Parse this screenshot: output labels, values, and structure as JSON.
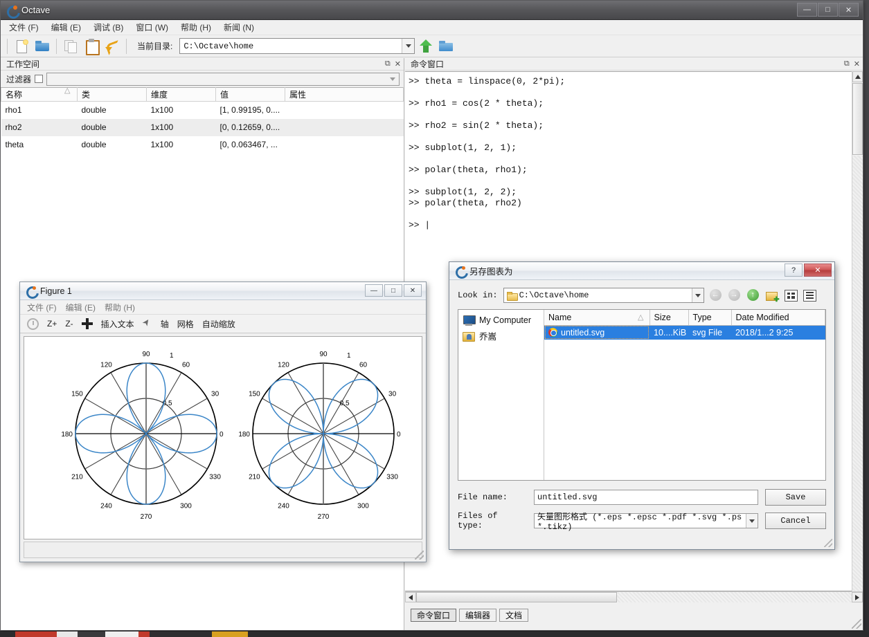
{
  "desktop": {
    "bg_color": "#3b3b3e"
  },
  "main_window": {
    "title": "Octave",
    "logo_icon": "octave-logo-icon",
    "controls": {
      "minimize": "—",
      "maximize": "□",
      "close": "✕"
    },
    "menubar": [
      {
        "label": "文件 (F)",
        "name": "menu-file"
      },
      {
        "label": "编辑 (E)",
        "name": "menu-edit"
      },
      {
        "label": "调试 (B)",
        "name": "menu-debug"
      },
      {
        "label": "窗口 (W)",
        "name": "menu-window"
      },
      {
        "label": "帮助 (H)",
        "name": "menu-help"
      },
      {
        "label": "新闻 (N)",
        "name": "menu-news"
      }
    ],
    "toolbar": {
      "icons": [
        "new-file-icon",
        "open-folder-icon",
        "copy-icon",
        "paste-icon",
        "undo-icon"
      ],
      "curdir_label": "当前目录:",
      "curdir_value": "C:\\Octave\\home",
      "up_icon": "up-arrow-icon",
      "browse_icon": "browse-folder-icon"
    }
  },
  "workspace": {
    "title": "工作空间",
    "undock_icon": "undock-icon",
    "close_icon": "close-icon",
    "filter_label": "过滤器",
    "filter_value": "",
    "columns": [
      "名称",
      "类",
      "维度",
      "值",
      "属性"
    ],
    "rows": [
      {
        "name": "rho1",
        "class": "double",
        "dimension": "1x100",
        "value": "[1, 0.99195, 0....",
        "attribute": ""
      },
      {
        "name": "rho2",
        "class": "double",
        "dimension": "1x100",
        "value": "[0, 0.12659, 0....",
        "attribute": ""
      },
      {
        "name": "theta",
        "class": "double",
        "dimension": "1x100",
        "value": "[0, 0.063467, ...",
        "attribute": ""
      }
    ]
  },
  "command_window": {
    "title": "命令窗口",
    "undock_icon": "undock-icon",
    "close_icon": "close-icon",
    "text": ">> theta = linspace(0, 2*pi);\n\n>> rho1 = cos(2 * theta);\n\n>> rho2 = sin(2 * theta);\n\n>> subplot(1, 2, 1);\n\n>> polar(theta, rho1);\n\n>> subplot(1, 2, 2);\n>> polar(theta, rho2)\n\n>> |",
    "tabs": [
      {
        "label": "命令窗口",
        "active": true
      },
      {
        "label": "编辑器",
        "active": false
      },
      {
        "label": "文档",
        "active": false
      }
    ]
  },
  "figure_window": {
    "title": "Figure 1",
    "logo_icon": "octave-logo-icon",
    "controls": {
      "minimize": "—",
      "maximize": "□",
      "close": "✕"
    },
    "menubar": [
      {
        "label": "文件 (F)",
        "name": "menu-file"
      },
      {
        "label": "编辑 (E)",
        "name": "menu-edit"
      },
      {
        "label": "帮助 (H)",
        "name": "menu-help"
      }
    ],
    "toolbar": [
      {
        "label": "",
        "icon": "clock-rotate-icon",
        "name": "tool-reset"
      },
      {
        "label": "Z+",
        "icon": "",
        "name": "tool-zoom-in"
      },
      {
        "label": "Z-",
        "icon": "",
        "name": "tool-zoom-out"
      },
      {
        "label": "",
        "icon": "move-icon",
        "name": "tool-pan"
      },
      {
        "label": "插入文本",
        "icon": "",
        "name": "tool-insert-text"
      },
      {
        "label": "",
        "icon": "cursor-icon",
        "name": "tool-select"
      },
      {
        "label": "轴",
        "icon": "",
        "name": "tool-axes"
      },
      {
        "label": "网格",
        "icon": "",
        "name": "tool-grid"
      },
      {
        "label": "自动缩放",
        "icon": "",
        "name": "tool-autoscale"
      }
    ]
  },
  "chart_data": [
    {
      "type": "line",
      "subtype": "polar",
      "title": "",
      "expression": "rho1 = cos(2 * theta)",
      "theta_labels": [
        "0",
        "30",
        "60",
        "90",
        "120",
        "150",
        "180",
        "210",
        "240",
        "270",
        "300",
        "330"
      ],
      "r_ticks": [
        0.5,
        1
      ],
      "r_tick_labels": [
        "0.5",
        "1"
      ],
      "rlim": [
        0,
        1
      ],
      "line_color": "#3b86c8",
      "grid_color": "#000000",
      "petals": 4,
      "petal_angles_deg": [
        0,
        90,
        180,
        270
      ],
      "x": [
        0,
        0.063467,
        0.126933,
        0.1904,
        0.253866,
        0.317333,
        0.380799,
        0.444266,
        0.507732,
        0.571199,
        0.634665,
        0.698132,
        0.761598,
        0.825065,
        0.888531,
        0.951998,
        1.015464,
        1.078931,
        1.142397,
        1.205864,
        1.26933,
        1.332797,
        1.396263,
        1.45973,
        1.523196,
        1.586663,
        1.650129,
        1.713596,
        1.777063,
        1.840529,
        1.903996,
        1.967462,
        2.030929,
        2.094395,
        2.157862,
        2.221328,
        2.284795,
        2.348261,
        2.411728,
        2.475194,
        2.538661,
        2.602127,
        2.665594,
        2.72906,
        2.792527,
        2.855993,
        2.91946,
        2.982926,
        3.046393,
        3.109859,
        3.173326,
        3.236792,
        3.300259,
        3.363725,
        3.427192,
        3.490659,
        3.554125,
        3.617592,
        3.681058,
        3.744525,
        3.807991,
        3.871458,
        3.934924,
        3.998391,
        4.061857,
        4.125324,
        4.18879,
        4.252257,
        4.315723,
        4.37919,
        4.442656,
        4.506123,
        4.569589,
        4.633056,
        4.696522,
        4.759989,
        4.823455,
        4.886922,
        4.950388,
        5.013855,
        5.077322,
        5.140788,
        5.204255,
        5.267721,
        5.331188,
        5.394654,
        5.458121,
        5.521587,
        5.585054,
        5.64852,
        5.711987,
        5.775453,
        5.83892,
        5.902386,
        5.965853,
        6.029319,
        6.092786,
        6.156252,
        6.219719,
        6.283185
      ],
      "y_formula": "cos(2*theta)"
    },
    {
      "type": "line",
      "subtype": "polar",
      "title": "",
      "expression": "rho2 = sin(2 * theta)",
      "theta_labels": [
        "0",
        "30",
        "60",
        "90",
        "120",
        "150",
        "180",
        "210",
        "240",
        "270",
        "300",
        "330"
      ],
      "r_ticks": [
        0.5,
        1
      ],
      "r_tick_labels": [
        "0.5",
        "1"
      ],
      "rlim": [
        0,
        1
      ],
      "line_color": "#3b86c8",
      "grid_color": "#000000",
      "petals": 4,
      "petal_angles_deg": [
        45,
        135,
        225,
        315
      ],
      "x": [
        0,
        0.063467,
        0.126933,
        0.1904,
        0.253866,
        0.317333,
        0.380799,
        0.444266,
        0.507732,
        0.571199,
        0.634665,
        0.698132,
        0.761598,
        0.825065,
        0.888531,
        0.951998,
        1.015464,
        1.078931,
        1.142397,
        1.205864,
        1.26933,
        1.332797,
        1.396263,
        1.45973,
        1.523196,
        1.586663,
        1.650129,
        1.713596,
        1.777063,
        1.840529,
        1.903996,
        1.967462,
        2.030929,
        2.094395,
        2.157862,
        2.221328,
        2.284795,
        2.348261,
        2.411728,
        2.475194,
        2.538661,
        2.602127,
        2.665594,
        2.72906,
        2.792527,
        2.855993,
        2.91946,
        2.982926,
        3.046393,
        3.109859,
        3.173326,
        3.236792,
        3.300259,
        3.363725,
        3.427192,
        3.490659,
        3.554125,
        3.617592,
        3.681058,
        3.744525,
        3.807991,
        3.871458,
        3.934924,
        3.998391,
        4.061857,
        4.125324,
        4.18879,
        4.252257,
        4.315723,
        4.37919,
        4.442656,
        4.506123,
        4.569589,
        4.633056,
        4.696522,
        4.759989,
        4.823455,
        4.886922,
        4.950388,
        5.013855,
        5.077322,
        5.140788,
        5.204255,
        5.267721,
        5.331188,
        5.394654,
        5.458121,
        5.521587,
        5.585054,
        5.64852,
        5.711987,
        5.775453,
        5.83892,
        5.902386,
        5.965853,
        6.029319,
        6.092786,
        6.156252,
        6.219719,
        6.283185
      ],
      "y_formula": "sin(2*theta)"
    }
  ],
  "save_dialog": {
    "title": "另存图表为",
    "logo_icon": "octave-logo-icon",
    "help_label": "?",
    "close_label": "✕",
    "lookin_label": "Look in:",
    "lookin_value": "C:\\Octave\\home",
    "nav_icons": [
      "back-arrow-icon",
      "forward-arrow-icon",
      "up-arrow-icon",
      "new-folder-icon",
      "list-view-icon",
      "detail-view-icon"
    ],
    "places": [
      {
        "label": "My Computer",
        "icon": "computer-icon"
      },
      {
        "label": "乔嵩",
        "icon": "user-folder-icon"
      }
    ],
    "file_columns": [
      "Name",
      "Size",
      "Type",
      "Date Modified"
    ],
    "files": [
      {
        "name": "untitled.svg",
        "size": "10....KiB",
        "type": "svg File",
        "date": "2018/1...2 9:25",
        "icon": "chrome-file-icon",
        "selected": true
      }
    ],
    "filename_label": "File name:",
    "filename_value": "untitled.svg",
    "filetype_label": "Files of type:",
    "filetype_value": "矢量图形格式 (*.eps *.epsc *.pdf *.svg *.ps *.tikz)",
    "save_button": "Save",
    "cancel_button": "Cancel"
  }
}
